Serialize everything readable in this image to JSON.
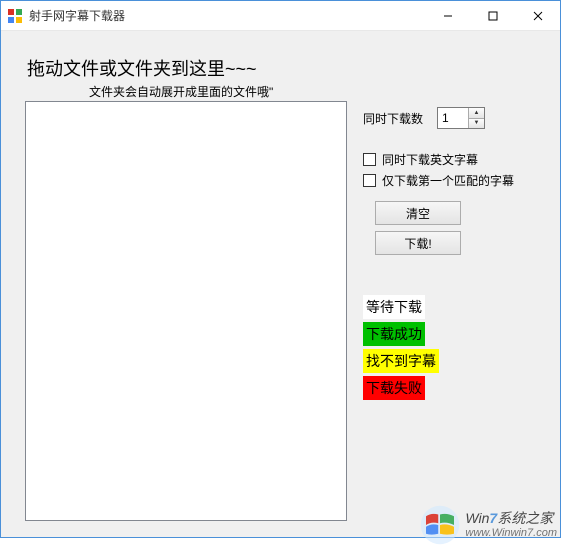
{
  "window": {
    "title": "射手网字幕下载器"
  },
  "drop": {
    "title": "拖动文件或文件夹到这里~~~",
    "subtitle": "文件夹会自动展开成里面的文件哦\""
  },
  "side": {
    "concurrent_label": "同时下载数",
    "concurrent_value": "1",
    "cb_english": "同时下载英文字幕",
    "cb_firstmatch": "仅下载第一个匹配的字幕",
    "btn_clear": "清空",
    "btn_download": "下载!"
  },
  "status": {
    "waiting": "等待下载",
    "success": "下载成功",
    "notfound": "找不到字幕",
    "failed": "下载失败"
  },
  "colors": {
    "success": "#00c000",
    "notfound": "#ffff00",
    "failed": "#ff0000"
  },
  "watermark": {
    "brand_prefix": "Win",
    "brand_seven": "7",
    "brand_suffix": "系统之家",
    "url": "www.Winwin7.com"
  }
}
